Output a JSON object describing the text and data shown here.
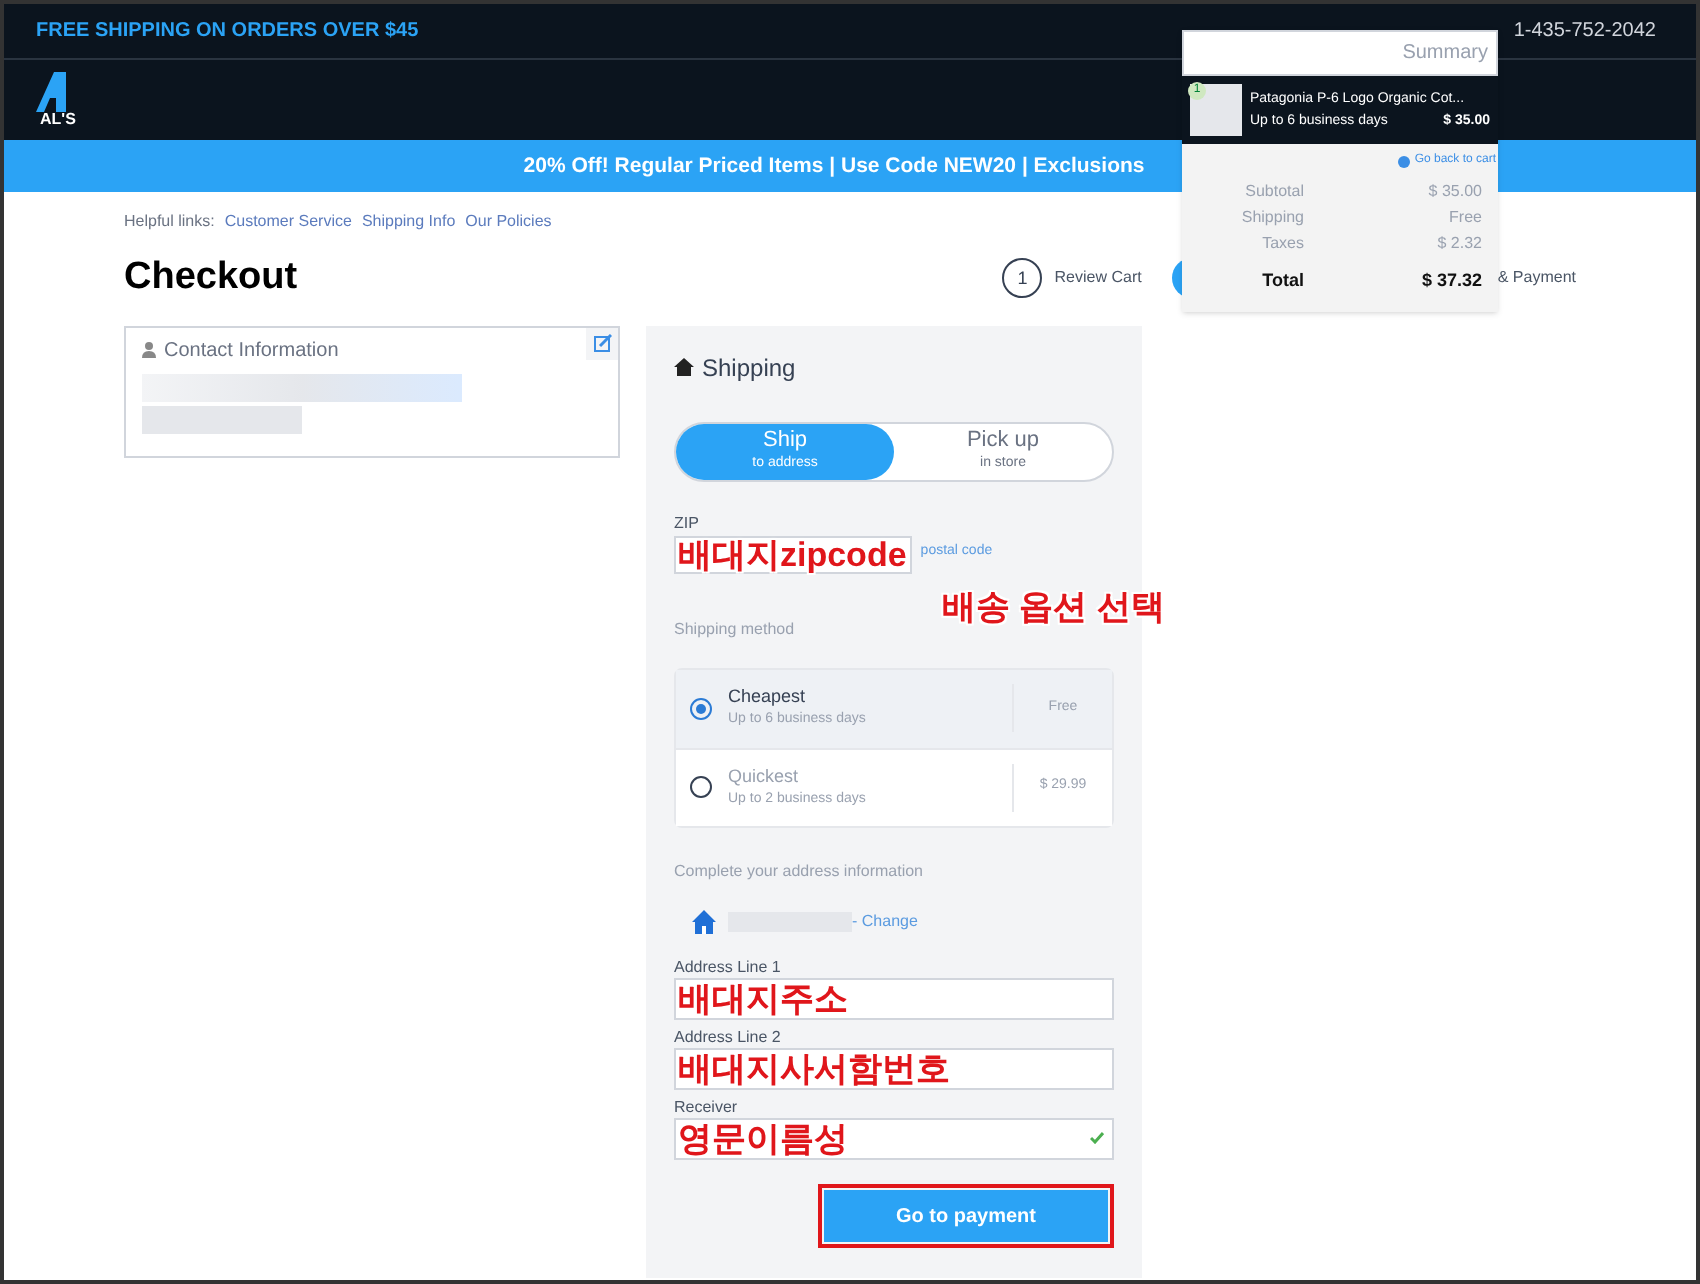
{
  "top_bar": {
    "promo": "FREE SHIPPING ON ORDERS OVER $45",
    "phone": "1-435-752-2042"
  },
  "logo": {
    "text": "AL'S"
  },
  "banner": "20% Off! Regular Priced Items | Use Code NEW20 | Exclusions",
  "helpful_links": {
    "label": "Helpful links:",
    "links": [
      "Customer Service",
      "Shipping Info",
      "Our Policies"
    ]
  },
  "page_title": "Checkout",
  "steps": [
    {
      "number": "1",
      "label": "Review Cart",
      "selected": false
    },
    {
      "label": "& Payment",
      "selected": true
    }
  ],
  "contact": {
    "title": "Contact Information"
  },
  "shipping": {
    "title": "Shipping",
    "modes": [
      {
        "label": "Ship",
        "sub": "to address",
        "selected": true
      },
      {
        "label": "Pick up",
        "sub": "in store",
        "selected": false
      }
    ],
    "zip": {
      "label": "ZIP",
      "link": "postal code",
      "annotation": "배대지zipcode"
    },
    "method_label": "Shipping method",
    "method_annotation": "배송 옵션 선택",
    "methods": [
      {
        "name": "Cheapest",
        "eta": "Up to 6 business days",
        "price": "Free",
        "selected": true
      },
      {
        "name": "Quickest",
        "eta": "Up to 2 business days",
        "price": "$ 29.99",
        "selected": false
      }
    ],
    "address_label": "Complete your address information",
    "change": "- Change",
    "fields": [
      {
        "label": "Address Line 1",
        "annotation": "배대지주소",
        "valid": false
      },
      {
        "label": "Address Line 2",
        "annotation": "배대지사서함번호",
        "valid": false
      },
      {
        "label": "Receiver",
        "annotation": "영문이름성",
        "valid": true
      }
    ],
    "submit": "Go to payment"
  },
  "summary": {
    "title": "Summary",
    "item": {
      "quantity": "1",
      "name": "Patagonia P-6 Logo Organic Cot...",
      "eta": "Up to 6 business days",
      "price": "$ 35.00"
    },
    "back_link": "Go back to cart",
    "lines": [
      {
        "label": "Subtotal",
        "value": "$ 35.00",
        "kind": "normal"
      },
      {
        "label": "Shipping",
        "value": "Free",
        "kind": "normal"
      },
      {
        "label": "Taxes",
        "value": "$ 2.32",
        "kind": "normal"
      },
      {
        "label": "Total",
        "value": "$ 37.32",
        "kind": "total"
      }
    ]
  }
}
